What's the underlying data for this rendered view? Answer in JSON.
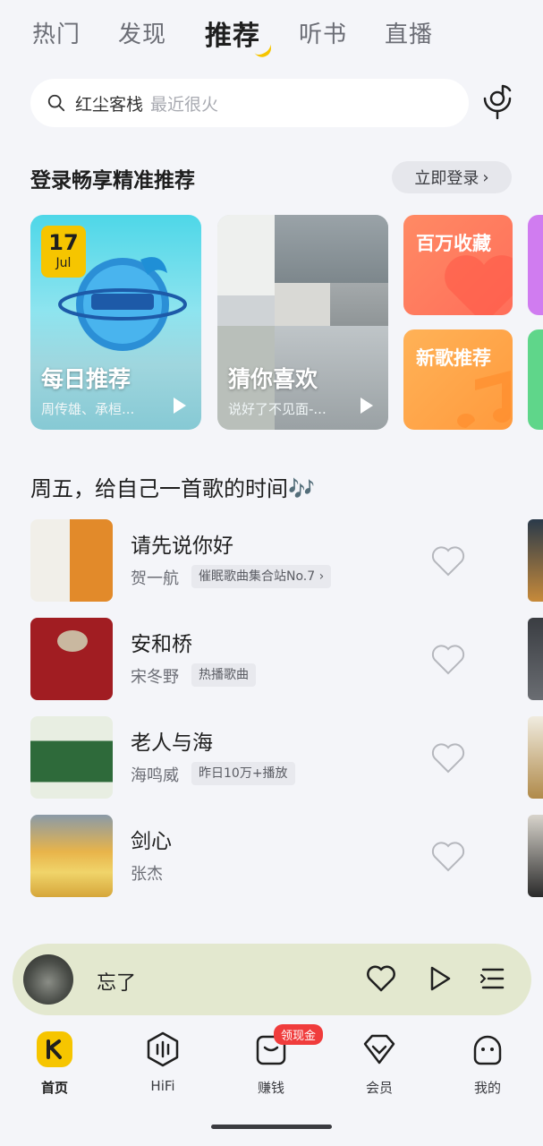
{
  "tabs": [
    {
      "label": "热门"
    },
    {
      "label": "发现"
    },
    {
      "label": "推荐",
      "active": true
    },
    {
      "label": "听书"
    },
    {
      "label": "直播"
    }
  ],
  "search": {
    "term": "红尘客栈",
    "hint": "最近很火"
  },
  "login": {
    "title": "登录畅享精准推荐",
    "button": "立即登录"
  },
  "cards": {
    "daily": {
      "day": "17",
      "month": "Jul",
      "title": "每日推荐",
      "subtitle": "周传雄、承桓..."
    },
    "guess": {
      "title": "猜你喜欢",
      "subtitle": "说好了不见面-..."
    },
    "fav": {
      "label": "百万收藏"
    },
    "new": {
      "label": "新歌推荐"
    }
  },
  "section": {
    "title": "周五，给自己一首歌的时间🎶"
  },
  "songs": [
    {
      "name": "请先说你好",
      "artist": "贺一航",
      "tag": "催眠歌曲集合站No.7 ›"
    },
    {
      "name": "安和桥",
      "artist": "宋冬野",
      "tag": "热播歌曲"
    },
    {
      "name": "老人与海",
      "artist": "海鸣威",
      "tag": "昨日10万+播放"
    },
    {
      "name": "剑心",
      "artist": "张杰",
      "tag": ""
    }
  ],
  "player": {
    "title": "忘了"
  },
  "nav": [
    {
      "label": "首页",
      "icon": "home-icon",
      "active": true
    },
    {
      "label": "HiFi",
      "icon": "hifi-icon"
    },
    {
      "label": "赚钱",
      "icon": "earn-icon",
      "badge": "领现金"
    },
    {
      "label": "会员",
      "icon": "vip-icon"
    },
    {
      "label": "我的",
      "icon": "profile-icon"
    }
  ],
  "colors": {
    "accent": "#f6c500",
    "badge": "#f03c3c",
    "player_bg": "#e3e8cf"
  }
}
